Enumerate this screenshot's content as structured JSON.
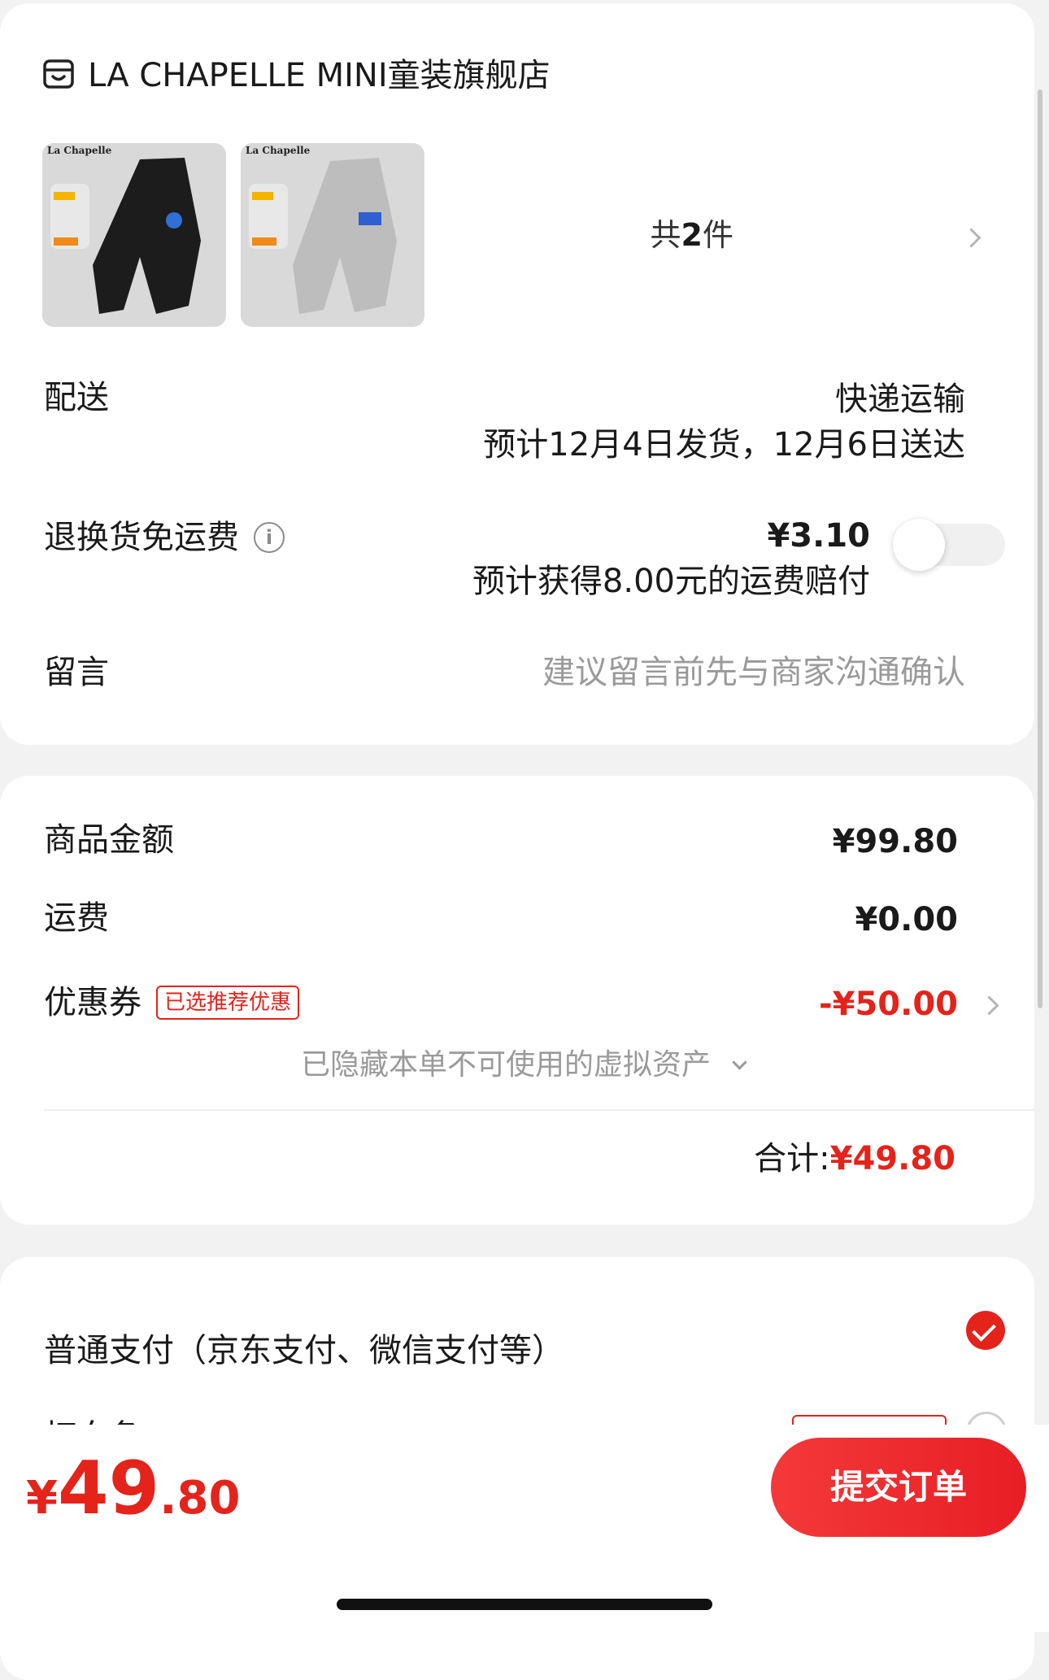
{
  "store": {
    "name": "LA CHAPELLE MINI童装旗舰店"
  },
  "products": {
    "items": [
      {
        "brand": "La Chapelle"
      },
      {
        "brand": "La Chapelle"
      }
    ],
    "count_prefix": "共",
    "count_num": "2",
    "count_suffix": "件"
  },
  "delivery": {
    "label": "配送",
    "method": "快递运输",
    "estimate": "预计12月4日发货，12月6日送达"
  },
  "return_shipping": {
    "label": "退换货免运费",
    "price": "¥3.10",
    "note": "预计获得8.00元的运费赔付",
    "enabled": false
  },
  "message": {
    "label": "留言",
    "placeholder": "建议留言前先与商家沟通确认"
  },
  "summary": {
    "goods_label": "商品金额",
    "goods_value": "¥99.80",
    "shipping_label": "运费",
    "shipping_value": "¥0.00",
    "coupon_label": "优惠券",
    "coupon_badge": "已选推荐优惠",
    "coupon_value": "-¥50.00",
    "hidden_assets": "已隐藏本单不可使用的虚拟资产",
    "total_label": "合计:",
    "total_value": "¥49.80"
  },
  "payment": {
    "option1": "普通支付（京东支付、微信支付等）",
    "option2_partial": "打白条"
  },
  "footer": {
    "yen": "¥",
    "total_int": "49",
    "total_dec": ".80",
    "submit": "提交订单"
  },
  "colors": {
    "accent": "#e4231b"
  }
}
